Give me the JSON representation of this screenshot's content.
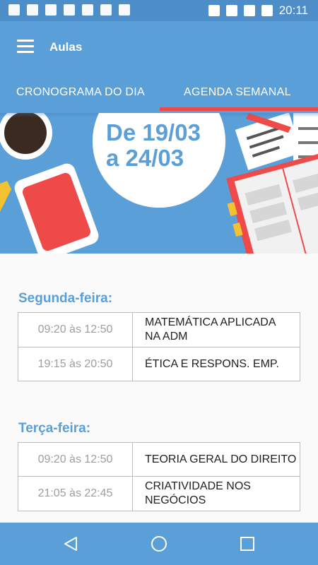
{
  "status": {
    "time": "20:11"
  },
  "appbar": {
    "title": "Aulas",
    "menu_icon": "hamburger-menu-icon"
  },
  "tabs": [
    {
      "label": "CRONOGRAMA DO DIA",
      "selected": false
    },
    {
      "label": "AGENDA SEMANAL",
      "selected": true
    }
  ],
  "banner": {
    "line1": "De 19/03",
    "line2": "a 24/03"
  },
  "days": [
    {
      "name": "Segunda-feira:",
      "classes": [
        {
          "time": "09:20 às 12:50",
          "l1": "MATEMÁTICA APLICADA",
          "l2": "NA ADM"
        },
        {
          "time": "19:15 às 20:50",
          "l1": "ÉTICA E RESPONS. EMP.",
          "l2": ""
        }
      ]
    },
    {
      "name": "Terça-feira:",
      "classes": [
        {
          "time": "09:20 às 12:50",
          "l1": "TEORIA GERAL DO DIREITO",
          "l2": ""
        },
        {
          "time": "21:05 às 22:45",
          "l1": "CRIATIVIDADE NOS",
          "l2": "NEGÓCIOS"
        }
      ]
    }
  ],
  "colors": {
    "primary": "#5b9fd8",
    "statusbar": "#4d8ec9",
    "indicator": "#ef4a4a"
  }
}
